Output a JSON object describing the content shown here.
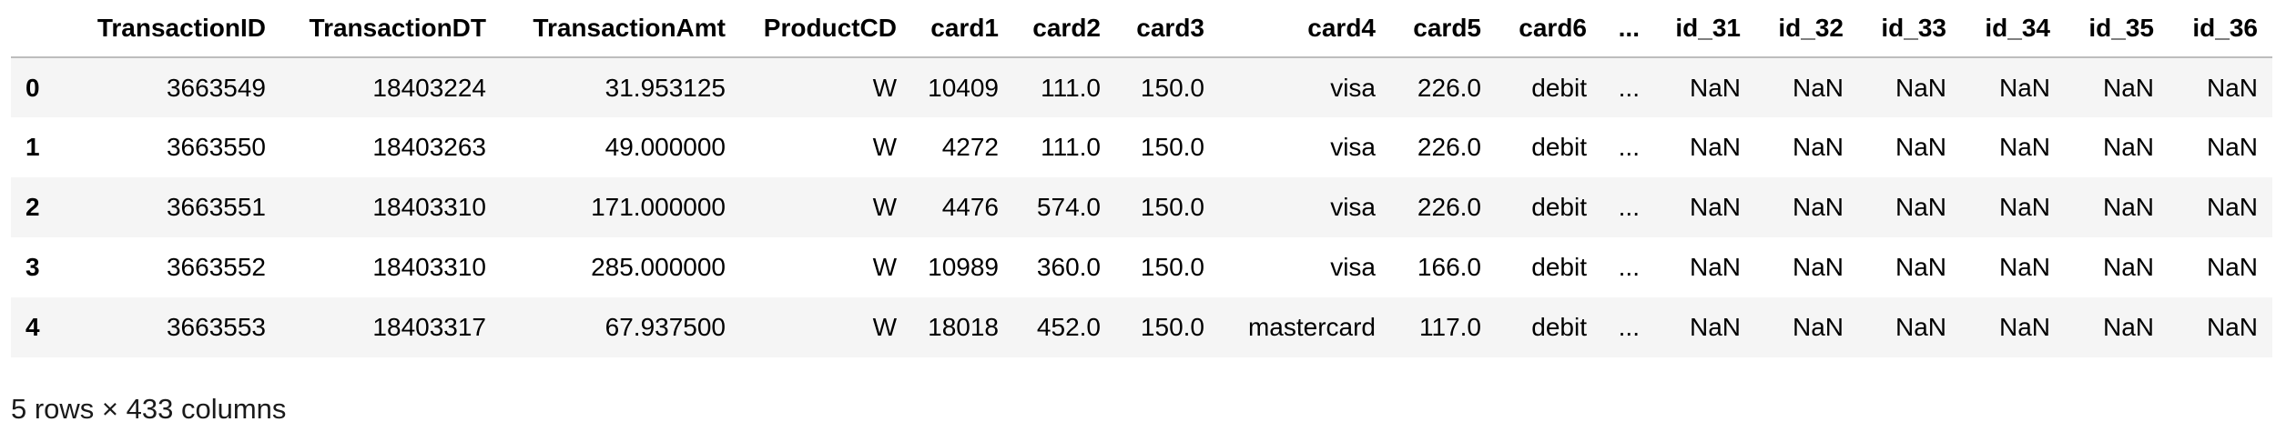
{
  "table": {
    "columns": [
      "",
      "TransactionID",
      "TransactionDT",
      "TransactionAmt",
      "ProductCD",
      "card1",
      "card2",
      "card3",
      "card4",
      "card5",
      "card6",
      "...",
      "id_31",
      "id_32",
      "id_33",
      "id_34",
      "id_35",
      "id_36"
    ],
    "rows": [
      [
        "0",
        "3663549",
        "18403224",
        "31.953125",
        "W",
        "10409",
        "111.0",
        "150.0",
        "visa",
        "226.0",
        "debit",
        "...",
        "NaN",
        "NaN",
        "NaN",
        "NaN",
        "NaN",
        "NaN"
      ],
      [
        "1",
        "3663550",
        "18403263",
        "49.000000",
        "W",
        "4272",
        "111.0",
        "150.0",
        "visa",
        "226.0",
        "debit",
        "...",
        "NaN",
        "NaN",
        "NaN",
        "NaN",
        "NaN",
        "NaN"
      ],
      [
        "2",
        "3663551",
        "18403310",
        "171.000000",
        "W",
        "4476",
        "574.0",
        "150.0",
        "visa",
        "226.0",
        "debit",
        "...",
        "NaN",
        "NaN",
        "NaN",
        "NaN",
        "NaN",
        "NaN"
      ],
      [
        "3",
        "3663552",
        "18403310",
        "285.000000",
        "W",
        "10989",
        "360.0",
        "150.0",
        "visa",
        "166.0",
        "debit",
        "...",
        "NaN",
        "NaN",
        "NaN",
        "NaN",
        "NaN",
        "NaN"
      ],
      [
        "4",
        "3663553",
        "18403317",
        "67.937500",
        "W",
        "18018",
        "452.0",
        "150.0",
        "mastercard",
        "117.0",
        "debit",
        "...",
        "NaN",
        "NaN",
        "NaN",
        "NaN",
        "NaN",
        "NaN"
      ]
    ]
  },
  "footer": {
    "summary": "5 rows × 433 columns"
  }
}
